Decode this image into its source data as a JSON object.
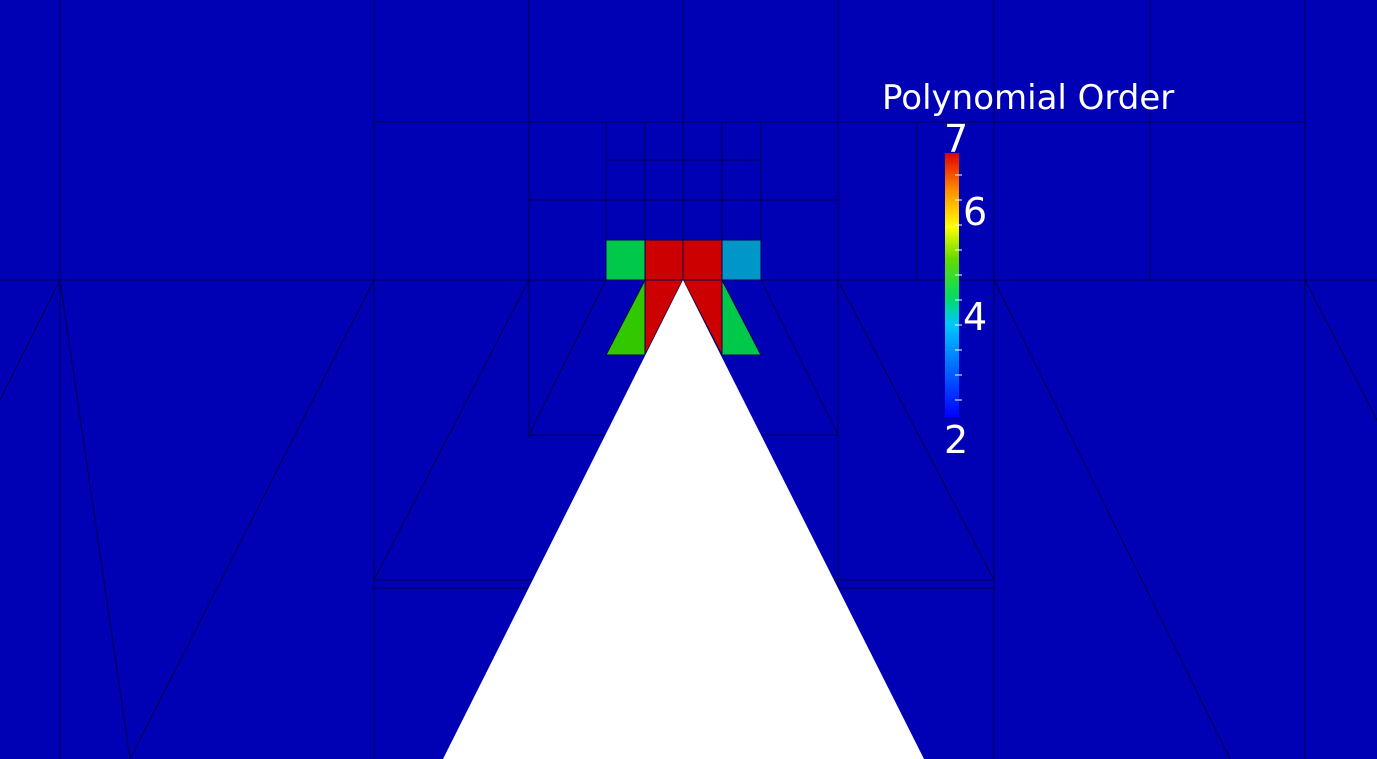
{
  "legend": {
    "title": "Polynomial Order",
    "max_label": "7",
    "min_label": "2",
    "tick_labels": [
      "6",
      "4"
    ],
    "colormap": [
      "#0000ff",
      "#00c8ff",
      "#00dc64",
      "#64dc00",
      "#ffff00",
      "#ff9600",
      "#e10000"
    ]
  },
  "colors": {
    "background": "#0000b4",
    "mesh_line": "#000050",
    "body": "#ffffff",
    "order_7": "#cc0000",
    "order_5": "#00c84b",
    "order_5b": "#32c800",
    "order_4": "#0096c8"
  }
}
